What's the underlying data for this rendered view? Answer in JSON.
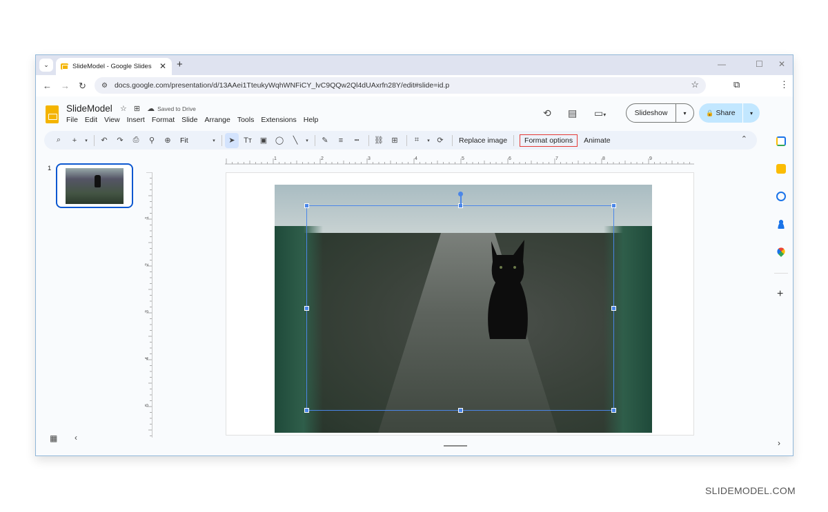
{
  "browser": {
    "tab_title": "SlideModel - Google Slides",
    "url": "docs.google.com/presentation/d/13AAei1TteukyWqhWNFiCY_lvC9QQw2Ql4dUAxrfn28Y/edit#slide=id.p",
    "icons": {
      "tab_dropdown": "⌄",
      "close": "✕",
      "new_tab": "+",
      "back": "←",
      "forward": "→",
      "reload": "↻",
      "site_info": "⚙",
      "bookmark": "☆",
      "extensions": "⧉",
      "menu": "⋮",
      "minimize": "—",
      "maximize": "☐",
      "close_window": "✕"
    }
  },
  "doc": {
    "title": "SlideModel",
    "saved_status": "Saved to Drive",
    "icons": {
      "star": "☆",
      "move": "⊞",
      "cloud": "☁"
    },
    "menu": [
      "File",
      "Edit",
      "View",
      "Insert",
      "Format",
      "Slide",
      "Arrange",
      "Tools",
      "Extensions",
      "Help"
    ],
    "header_icons": {
      "history": "⟲",
      "comments": "▤",
      "meet": "▭"
    },
    "slideshow_label": "Slideshow",
    "share_label": "Share",
    "share_icon": "🔒",
    "dropdown_icon": "▾"
  },
  "toolbar": {
    "icons": {
      "search": "⌕",
      "add": "+",
      "undo": "↶",
      "redo": "↷",
      "print": "⎙",
      "paint_format": "⚲",
      "zoom": "⊕",
      "select": "➤",
      "textbox": "Tт",
      "image": "▣",
      "shape": "◯",
      "line": "╲",
      "pen": "✎",
      "border_weight": "≡",
      "border_dash": "┅",
      "link": "⛓",
      "comment": "⊞",
      "crop": "⌗",
      "reset_image": "⟳",
      "collapse": "⌃"
    },
    "zoom_value": "Fit",
    "replace_image": "Replace image",
    "format_options": "Format options",
    "animate": "Animate"
  },
  "filmstrip": {
    "slides": [
      {
        "number": "1"
      }
    ],
    "grid_icon": "▦",
    "collapse_icon": "‹"
  },
  "rulers": {
    "horizontal": [
      "1",
      "2",
      "3",
      "4",
      "5",
      "6",
      "7",
      "8",
      "9"
    ],
    "vertical": [
      "1",
      "2",
      "3",
      "4",
      "5"
    ]
  },
  "side_panel": {
    "apps": [
      "Calendar",
      "Keep",
      "Tasks",
      "Contacts",
      "Maps"
    ],
    "add_icon": "+",
    "expand_icon": "›"
  },
  "watermark": "SLIDEMODEL.COM",
  "colors": {
    "accent": "#0b57d0",
    "share_bg": "#c2e7ff",
    "highlight": "#e53935",
    "selection": "#4a86e8"
  }
}
